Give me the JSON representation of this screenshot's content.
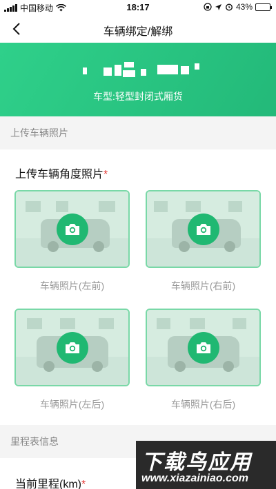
{
  "status_bar": {
    "carrier": "中国移动",
    "time": "18:17",
    "battery_percent": "43%",
    "battery_level": 0.43
  },
  "nav": {
    "title": "车辆绑定/解绑"
  },
  "vehicle": {
    "type_text": "车型:轻型封闭式厢货"
  },
  "upload_section": {
    "header": "上传车辆照片",
    "title": "上传车辆角度照片",
    "required_mark": "*",
    "photos": [
      {
        "caption": "车辆照片(左前)"
      },
      {
        "caption": "车辆照片(右前)"
      },
      {
        "caption": "车辆照片(左后)"
      },
      {
        "caption": "车辆照片(右后)"
      }
    ]
  },
  "odometer_section": {
    "header": "里程表信息",
    "title": "当前里程(km)",
    "required_mark": "*"
  },
  "watermark": {
    "title": "下载鸟应用",
    "url": "www.xiazainiao.com"
  },
  "colors": {
    "accent_green": "#23b979",
    "photo_border": "#79d8a7",
    "required_red": "#e53935"
  }
}
